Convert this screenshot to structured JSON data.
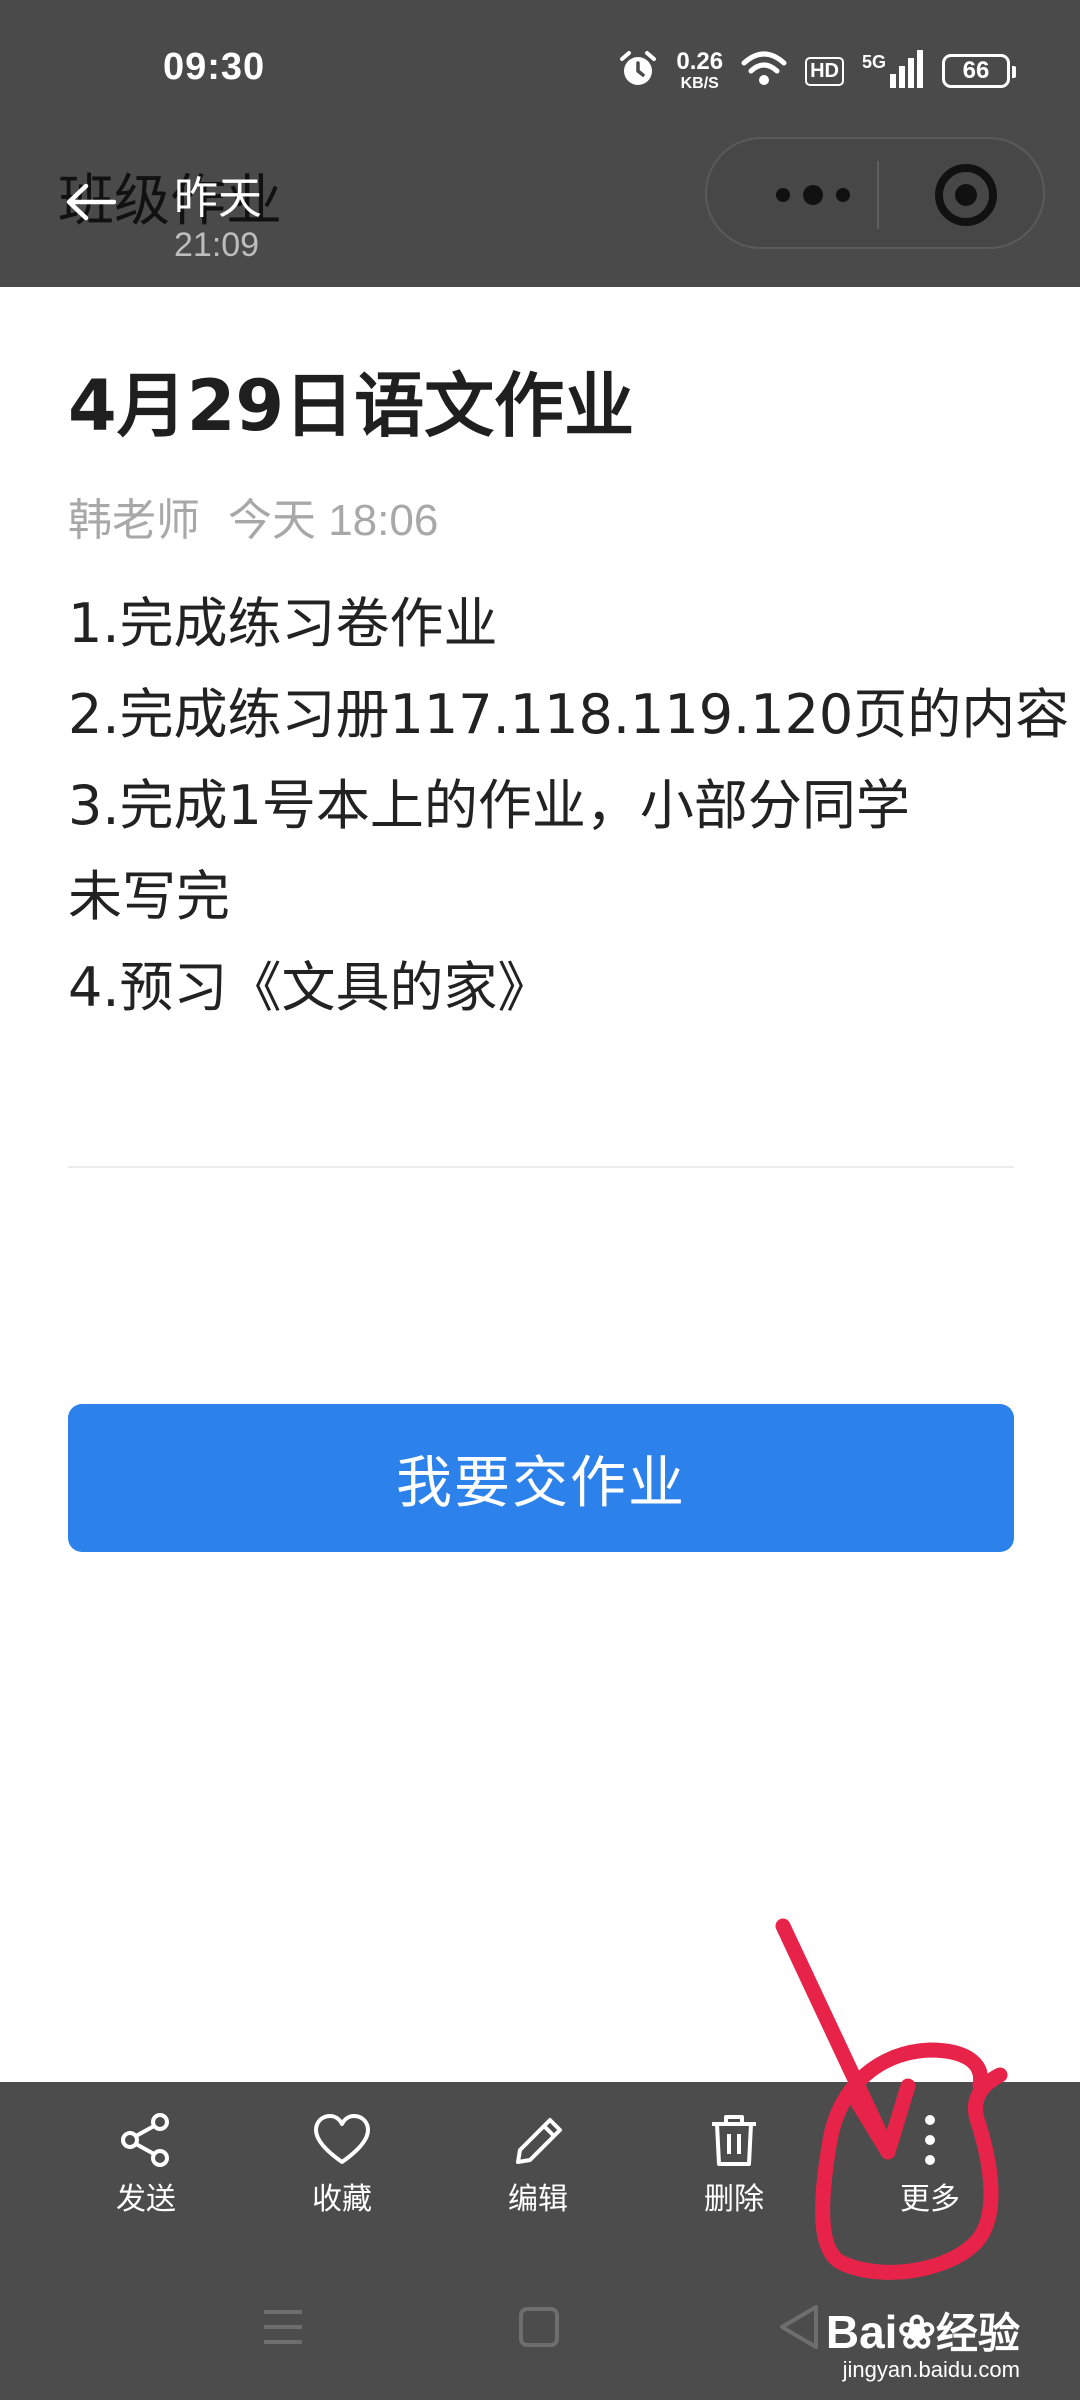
{
  "status_bar": {
    "time": "09:30",
    "net_speed_value": "0.26",
    "net_speed_unit": "KB/S",
    "hd_badge": "HD",
    "network_type": "5G",
    "battery": "66"
  },
  "nav": {
    "title": "班级作业",
    "date": "昨天",
    "time": "21:09"
  },
  "homework": {
    "title": "4月29日语文作业",
    "teacher": "韩老师",
    "posted": "今天 18:06",
    "lines": [
      "1.完成练习卷作业",
      "2.完成练习册117.118.119.120页的内容",
      "3.完成1号本上的作业，小部分同学",
      "未写完",
      "4.预习《文具的家》"
    ]
  },
  "submit_button": "我要交作业",
  "toolbar": {
    "send": "发送",
    "favorite": "收藏",
    "edit": "编辑",
    "delete": "删除",
    "more": "更多"
  },
  "watermark": {
    "logo_text": "Bai",
    "logo_cn": "经验",
    "url": "jingyan.baidu.com"
  },
  "colors": {
    "header_bg": "#4a4a4a",
    "accent_button": "#2c81ea",
    "toolbar_bg": "#4c4c4c",
    "annotation_red": "#e8234a"
  }
}
